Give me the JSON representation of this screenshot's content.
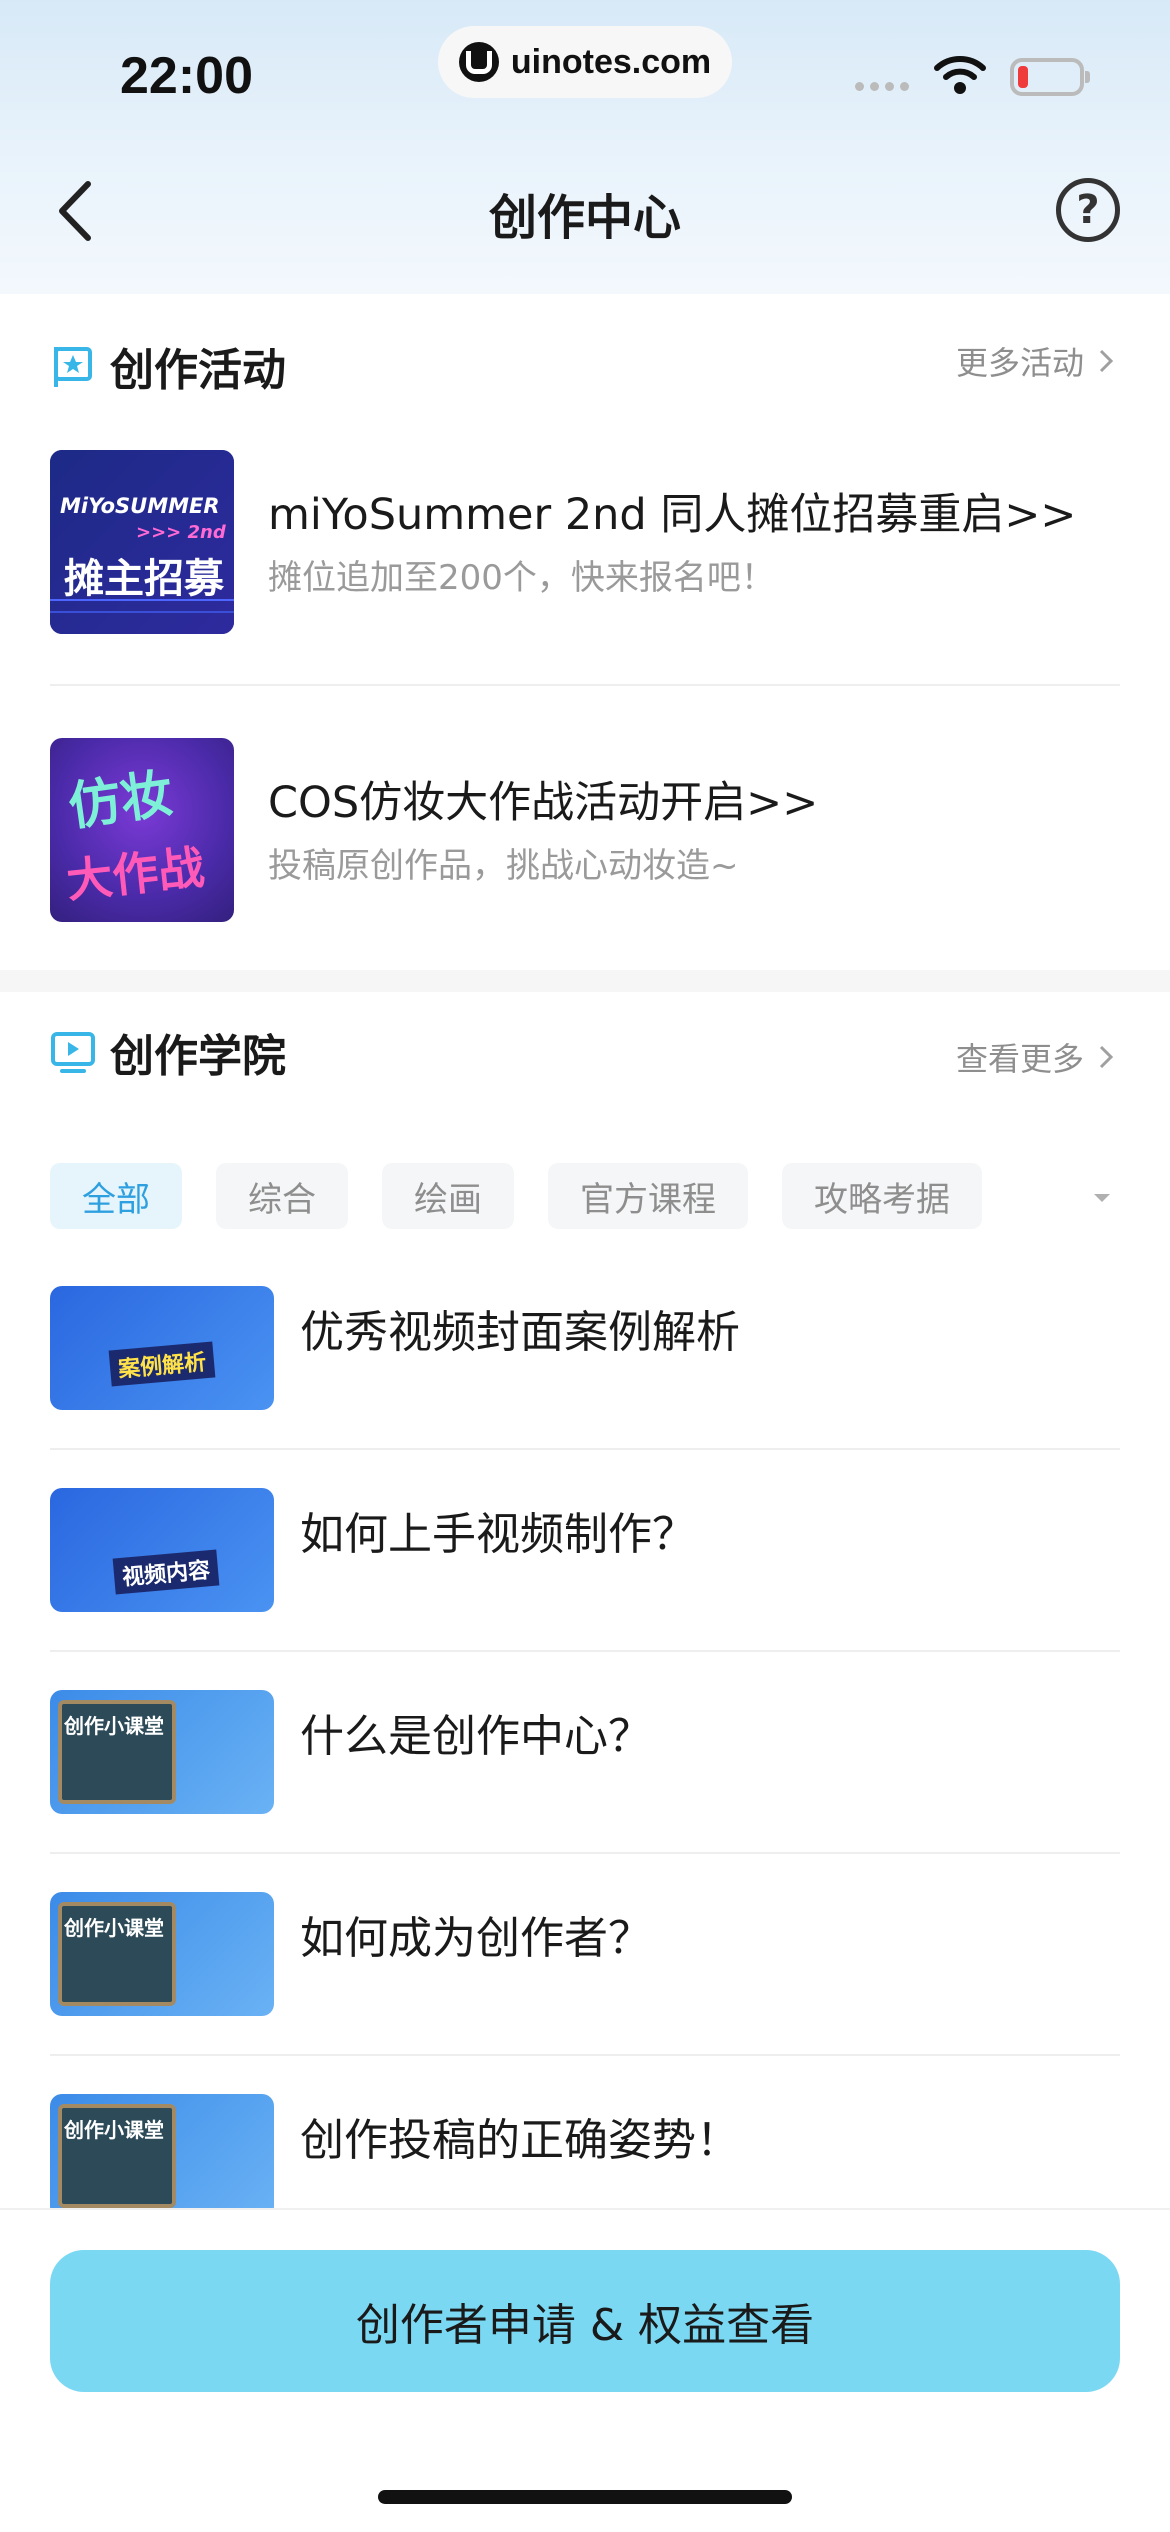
{
  "status_bar": {
    "time": "22:00",
    "url": "uinotes.com"
  },
  "nav": {
    "title": "创作中心",
    "help": "?"
  },
  "activities": {
    "title": "创作活动",
    "more": "更多活动",
    "items": [
      {
        "title": "miYoSummer 2nd 同人摊位招募重启>>",
        "subtitle": "摊位追加至200个，快来报名吧！",
        "thumb_text_top": "MiYoSUMMER",
        "thumb_text_mid": ">>> 2nd",
        "thumb_text_main": "摊主招募"
      },
      {
        "title": "COS仿妆大作战活动开启>>",
        "subtitle": "投稿原创作品，挑战心动妆造~",
        "thumb_text_main": "仿妆",
        "thumb_text_sub": "大作战"
      }
    ]
  },
  "academy": {
    "title": "创作学院",
    "more": "查看更多",
    "tabs": [
      "全部",
      "综合",
      "绘画",
      "官方课程",
      "攻略考据"
    ],
    "courses": [
      {
        "title": "优秀视频封面案例解析",
        "thumb_text": "案例解析"
      },
      {
        "title": "如何上手视频制作？",
        "thumb_text": "视频内容"
      },
      {
        "title": "什么是创作中心？",
        "thumb_text": "创作小课堂"
      },
      {
        "title": "如何成为创作者？",
        "thumb_text": "创作小课堂"
      },
      {
        "title": "创作投稿的正确姿势！",
        "thumb_text": "创作小课堂"
      }
    ]
  },
  "cta": {
    "label": "创作者申请 & 权益查看"
  }
}
